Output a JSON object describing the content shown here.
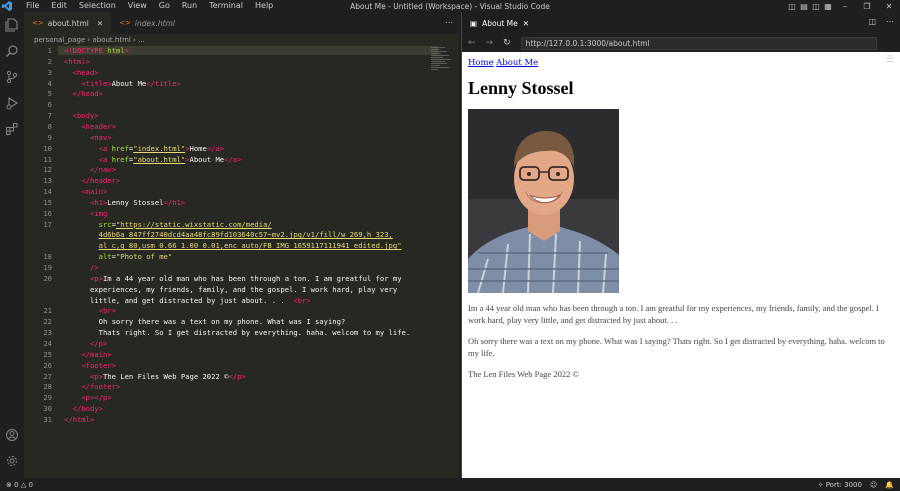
{
  "titlebar": {
    "menu": [
      "File",
      "Edit",
      "Selection",
      "View",
      "Go",
      "Run",
      "Terminal",
      "Help"
    ],
    "window_title": "About Me - Untitled (Workspace) - Visual Studio Code"
  },
  "editor": {
    "tabs": [
      {
        "label": "about.html",
        "active": true
      },
      {
        "label": "index.html",
        "active": false
      }
    ],
    "breadcrumb": "personal_page  ›  about.html  ›  ...",
    "lines": [
      {
        "n": "1",
        "html": "<span class=\"t\">&lt;!DOCTYPE</span> <span class=\"a\">html</span><span class=\"t\">&gt;</span>"
      },
      {
        "n": "2",
        "html": "<span class=\"t\">&lt;html&gt;</span>"
      },
      {
        "n": "3",
        "html": "  <span class=\"t\">&lt;head&gt;</span>"
      },
      {
        "n": "4",
        "html": "    <span class=\"t\">&lt;title&gt;</span>About Me<span class=\"t\">&lt;/title&gt;</span>"
      },
      {
        "n": "5",
        "html": "  <span class=\"t\">&lt;/head&gt;</span>"
      },
      {
        "n": "6",
        "html": ""
      },
      {
        "n": "7",
        "html": "  <span class=\"t\">&lt;body&gt;</span>"
      },
      {
        "n": "8",
        "html": "    <span class=\"t\">&lt;header&gt;</span>"
      },
      {
        "n": "9",
        "html": "      <span class=\"t\">&lt;nav&gt;</span>"
      },
      {
        "n": "10",
        "html": "        <span class=\"t\">&lt;a</span> <span class=\"a\">href</span>=<span class=\"s u\">\"index.html\"</span><span class=\"t\">&gt;</span>Home<span class=\"t\">&lt;/a&gt;</span>"
      },
      {
        "n": "11",
        "html": "        <span class=\"t\">&lt;a</span> <span class=\"a\">href</span>=<span class=\"s u\">\"about.html\"</span><span class=\"t\">&gt;</span>About Me<span class=\"t\">&lt;/a&gt;</span>"
      },
      {
        "n": "12",
        "html": "      <span class=\"t\">&lt;/nav&gt;</span>"
      },
      {
        "n": "13",
        "html": "    <span class=\"t\">&lt;/header&gt;</span>"
      },
      {
        "n": "14",
        "html": "    <span class=\"t\">&lt;main&gt;</span>"
      },
      {
        "n": "15",
        "html": "      <span class=\"t\">&lt;h1&gt;</span>Lenny Stossel<span class=\"t\">&lt;/h1&gt;</span>"
      },
      {
        "n": "16",
        "html": "      <span class=\"t\">&lt;img</span>"
      },
      {
        "n": "17",
        "html": "        <span class=\"a\">src</span>=<span class=\"s u\">\"https://static.wixstatic.com/media/</span>"
      },
      {
        "n": "",
        "html": "        <span class=\"s u\">4d6b6a_847ff2740dcd4aa48fc89fd103640c57~mv2.jpg/v1/fill/w_269,h_323,</span>"
      },
      {
        "n": "",
        "html": "        <span class=\"s u\">al_c,q_80,usm_0.66_1.00_0.01,enc_auto/FB_IMG_1659117111941_edited.jpg\"</span>"
      },
      {
        "n": "18",
        "html": "        <span class=\"a\">alt</span>=<span class=\"s\">\"Photo of me\"</span>"
      },
      {
        "n": "19",
        "html": "      <span class=\"t\">/&gt;</span>"
      },
      {
        "n": "20",
        "html": "      <span class=\"t\">&lt;p&gt;</span>Im a 44 year old man who has been through a ton. I am greatful for my"
      },
      {
        "n": "",
        "html": "      experiences, my friends, family, and the gospel. I work hard, play very"
      },
      {
        "n": "",
        "html": "      little, and get distracted by just about. . .  <span class=\"t\">&lt;br&gt;</span>"
      },
      {
        "n": "21",
        "html": "        <span class=\"t\">&lt;br&gt;</span>"
      },
      {
        "n": "22",
        "html": "        Oh sorry there was a text on my phone. What was I saying?"
      },
      {
        "n": "23",
        "html": "        Thats right. So I get distracted by everything. haha. welcom to my life."
      },
      {
        "n": "24",
        "html": "      <span class=\"t\">&lt;/p&gt;</span>"
      },
      {
        "n": "25",
        "html": "    <span class=\"t\">&lt;/main&gt;</span>"
      },
      {
        "n": "26",
        "html": "    <span class=\"t\">&lt;footer&gt;</span>"
      },
      {
        "n": "27",
        "html": "      <span class=\"t\">&lt;p&gt;</span>The Len Files Web Page 2022 &#169;<span class=\"t\">&lt;/p&gt;</span>"
      },
      {
        "n": "28",
        "html": "    <span class=\"t\">&lt;/footer&gt;</span>"
      },
      {
        "n": "29",
        "html": "    <span class=\"t\">&lt;p&gt;&lt;/p&gt;</span>"
      },
      {
        "n": "30",
        "html": "  <span class=\"t\">&lt;/body&gt;</span>"
      },
      {
        "n": "31",
        "html": "<span class=\"t\">&lt;/html&gt;</span>"
      }
    ]
  },
  "browser": {
    "tab_label": "About Me",
    "url": "http://127.0.0.1:3000/about.html",
    "page": {
      "link_home": "Home",
      "link_about": "About Me",
      "heading": "Lenny Stossel",
      "photo_alt": "Photo of me",
      "para1": "Im a 44 year old man who has been through a ton. I am greatful for my experiences, my friends, family, and the gospel. I work hard, play very little, and get distracted by just about. . .",
      "para2": "Oh sorry there was a text on my phone. What was I saying? Thats right. So I get distracted by everything. haha. welcom to my life.",
      "footer": "The Len Files Web Page 2022 ©"
    }
  },
  "statusbar": {
    "problems": "0",
    "warnings": "0",
    "port": "Port: 3000"
  }
}
